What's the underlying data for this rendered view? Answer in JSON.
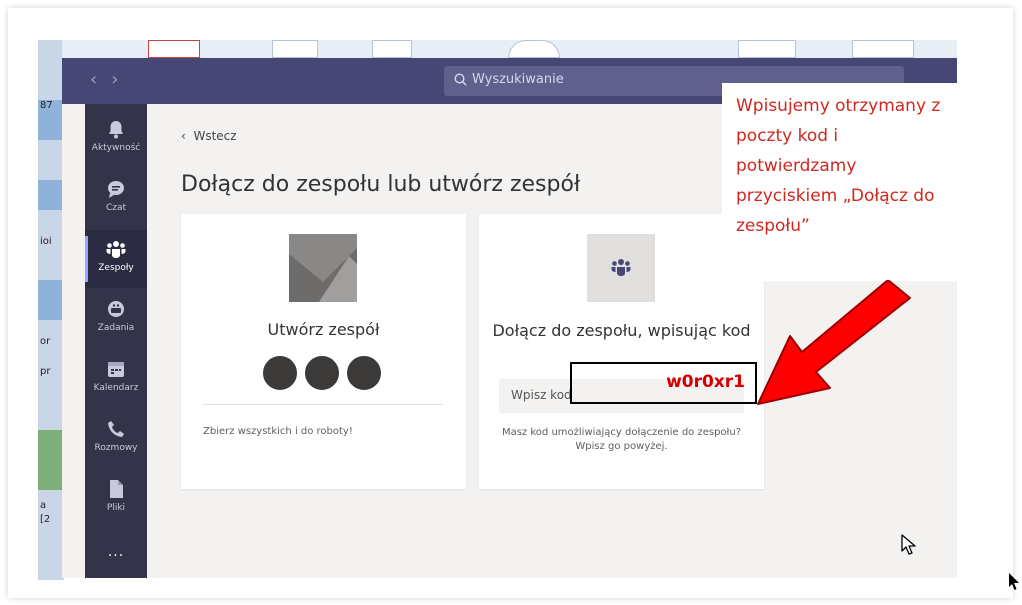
{
  "search": {
    "placeholder": "Wyszukiwanie"
  },
  "rail": {
    "items": [
      {
        "label": "Aktywność",
        "icon": "bell-icon"
      },
      {
        "label": "Czat",
        "icon": "chat-icon"
      },
      {
        "label": "Zespoły",
        "icon": "teams-icon"
      },
      {
        "label": "Zadania",
        "icon": "tasks-icon"
      },
      {
        "label": "Kalendarz",
        "icon": "calendar-icon"
      },
      {
        "label": "Rozmowy",
        "icon": "phone-icon"
      },
      {
        "label": "Pliki",
        "icon": "file-icon"
      }
    ],
    "active": "Zespoły",
    "more": "..."
  },
  "main": {
    "back_label": "Wstecz",
    "title": "Dołącz do zespołu lub utwórz zespół",
    "create_card": {
      "heading": "Utwórz zespół",
      "subtitle": "Zbierz wszystkich i do roboty!"
    },
    "join_card": {
      "heading": "Dołącz do zespołu, wpisując kod",
      "input_placeholder": "Wpisz kod",
      "subtitle": "Masz kod umożliwiający dołączenie do zespołu? Wpisz go powyżej."
    }
  },
  "annotation": {
    "text": "Wpisujemy otrzymany z poczty kod i potwierdzamy przyciskiem „Dołącz do zespołu”",
    "code_value": "w0r0xr1",
    "text_color": "#d0281f",
    "arrow_color": "#ff0000"
  },
  "colors": {
    "titlebar": "#464775",
    "rail": "#33344a",
    "background": "#f3f2f1"
  },
  "desktop": {
    "left_labels": [
      "87",
      "ioi",
      "or",
      "pr",
      "a",
      "[2"
    ]
  }
}
